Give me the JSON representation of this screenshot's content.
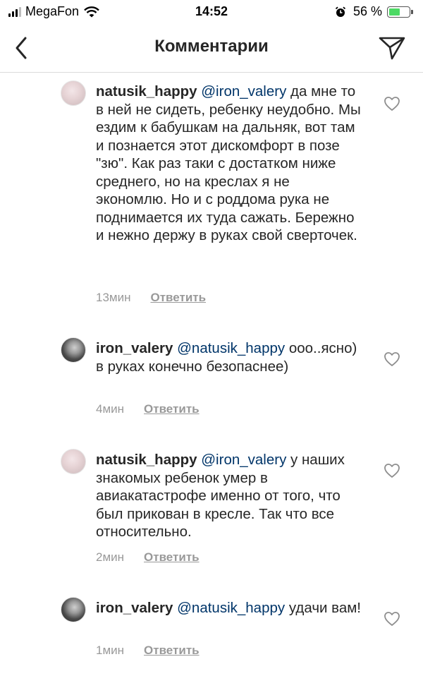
{
  "status_bar": {
    "carrier": "MegaFon",
    "time": "14:52",
    "battery": "56 %",
    "battery_level": 0.56
  },
  "header": {
    "title": "Комментарии"
  },
  "comments": [
    {
      "username": "natusik_happy",
      "mention": "@iron_valery",
      "text": "да мне то в ней не сидеть, ребенку неудобно. Мы ездим к бабушкам на дальняк, вот там и познается этот дискомфорт в позе \"зю\". Как раз таки с достатком ниже среднего, но на креслах я не экономлю. Но и с роддома рука не поднимается их туда сажать. Бережно и нежно держу в руках свой сверточек.",
      "time": "13мин",
      "reply_label": "Ответить"
    },
    {
      "username": "iron_valery",
      "mention": "@natusik_happy",
      "text": "ооо..ясно) в руках конечно безопаснее)",
      "time": "4мин",
      "reply_label": "Ответить"
    },
    {
      "username": "natusik_happy",
      "mention": "@iron_valery",
      "text": "у наших знакомых ребенок умер в авиакатастрофе именно от того, что был прикован в кресле. Так что все относительно.",
      "time": "2мин",
      "reply_label": "Ответить"
    },
    {
      "username": "iron_valery",
      "mention": "@natusik_happy",
      "text": "удачи вам!",
      "time": "1мин",
      "reply_label": "Ответить"
    }
  ]
}
